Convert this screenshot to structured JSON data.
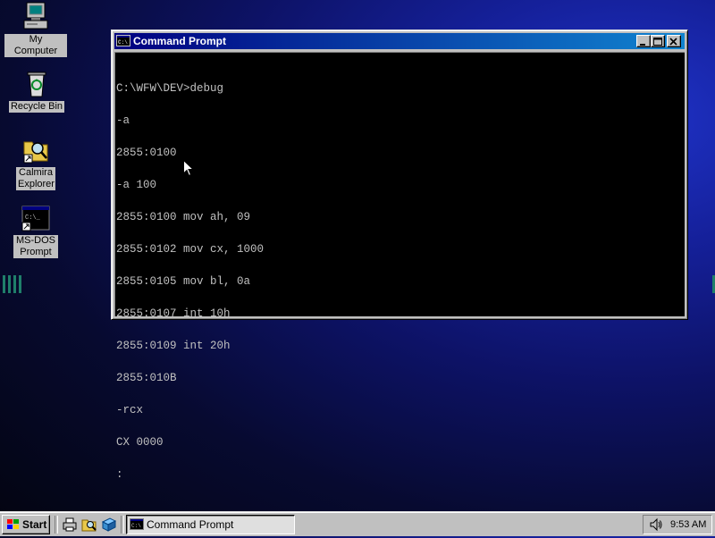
{
  "desktop": {
    "icons": [
      {
        "label": "My Computer",
        "icon": "computer-icon"
      },
      {
        "label": "Recycle Bin",
        "icon": "recycle-bin-icon"
      },
      {
        "label": "Calmira Explorer",
        "icon": "explorer-icon"
      },
      {
        "label": "MS-DOS Prompt",
        "icon": "msdos-icon"
      }
    ],
    "background_color": "#0d1266"
  },
  "window": {
    "title": "Command Prompt",
    "titlebar_color": "#000080",
    "lines": [
      "C:\\WFW\\DEV>debug",
      "-a",
      "2855:0100",
      "-a 100",
      "2855:0100 mov ah, 09",
      "2855:0102 mov cx, 1000",
      "2855:0105 mov bl, 0a",
      "2855:0107 int 10h",
      "2855:0109 int 20h",
      "2855:010B",
      "-rcx",
      "CX 0000",
      ":"
    ]
  },
  "taskbar": {
    "start_label": "Start",
    "task_label": "Command Prompt",
    "clock": "9:53 AM"
  }
}
